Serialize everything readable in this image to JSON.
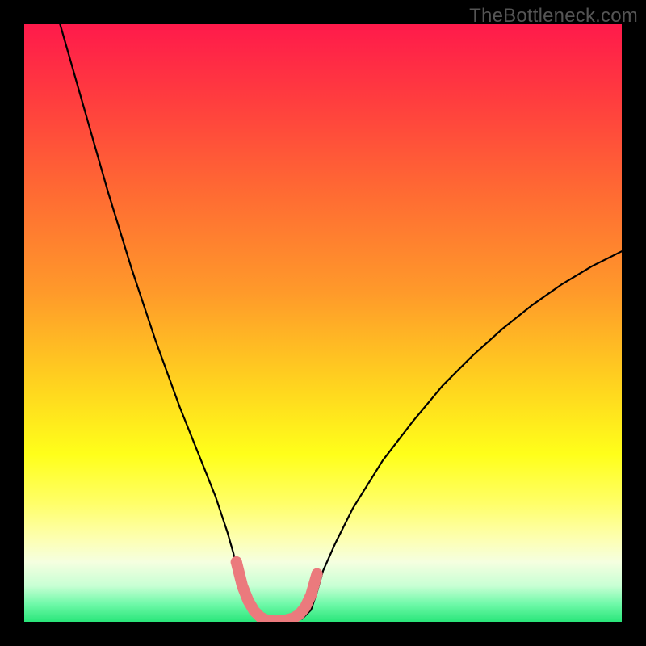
{
  "watermark": "TheBottleneck.com",
  "gradient": {
    "stops": [
      {
        "offset": 0.0,
        "color": "#ff1a4b"
      },
      {
        "offset": 0.12,
        "color": "#ff3b3f"
      },
      {
        "offset": 0.28,
        "color": "#ff6a33"
      },
      {
        "offset": 0.45,
        "color": "#ff9a2a"
      },
      {
        "offset": 0.6,
        "color": "#ffd21f"
      },
      {
        "offset": 0.72,
        "color": "#ffff1a"
      },
      {
        "offset": 0.8,
        "color": "#ffff66"
      },
      {
        "offset": 0.86,
        "color": "#fdffb0"
      },
      {
        "offset": 0.9,
        "color": "#f5ffe0"
      },
      {
        "offset": 0.94,
        "color": "#c8ffd4"
      },
      {
        "offset": 0.97,
        "color": "#70f9a9"
      },
      {
        "offset": 1.0,
        "color": "#29e67a"
      }
    ]
  },
  "chart_data": {
    "type": "line",
    "title": "",
    "xlabel": "",
    "ylabel": "",
    "xlim": [
      0,
      100
    ],
    "ylim": [
      0,
      100
    ],
    "series": [
      {
        "name": "bottleneck-curve",
        "color": "#000000",
        "x": [
          6,
          8,
          10,
          12,
          14,
          16,
          18,
          20,
          22,
          24,
          26,
          27,
          28,
          29,
          30,
          31,
          32,
          33,
          34,
          35,
          36,
          38,
          39,
          40,
          42,
          44,
          46.5,
          48,
          49,
          50,
          52,
          55,
          60,
          65,
          70,
          75,
          80,
          85,
          90,
          95,
          100
        ],
        "y": [
          100,
          93,
          86,
          79,
          72,
          65.5,
          59,
          53,
          47,
          41.5,
          36,
          33.5,
          31,
          28.5,
          26,
          23.5,
          21,
          18,
          15,
          11.5,
          7,
          2,
          0.5,
          0,
          0,
          0,
          0.5,
          2,
          5,
          8.5,
          13,
          19,
          27,
          33.5,
          39.5,
          44.5,
          49,
          53,
          56.5,
          59.5,
          62
        ]
      },
      {
        "name": "highlight-band",
        "color": "#eb7a7d",
        "stroke_width": 14,
        "x": [
          35.5,
          36.5,
          37.5,
          38.5,
          39.5,
          40.5,
          42,
          43.5,
          45,
          46,
          47,
          48,
          49
        ],
        "y": [
          10,
          6,
          3.5,
          1.8,
          0.8,
          0.3,
          0.1,
          0.2,
          0.6,
          1.2,
          2.4,
          4.5,
          8
        ]
      }
    ]
  }
}
